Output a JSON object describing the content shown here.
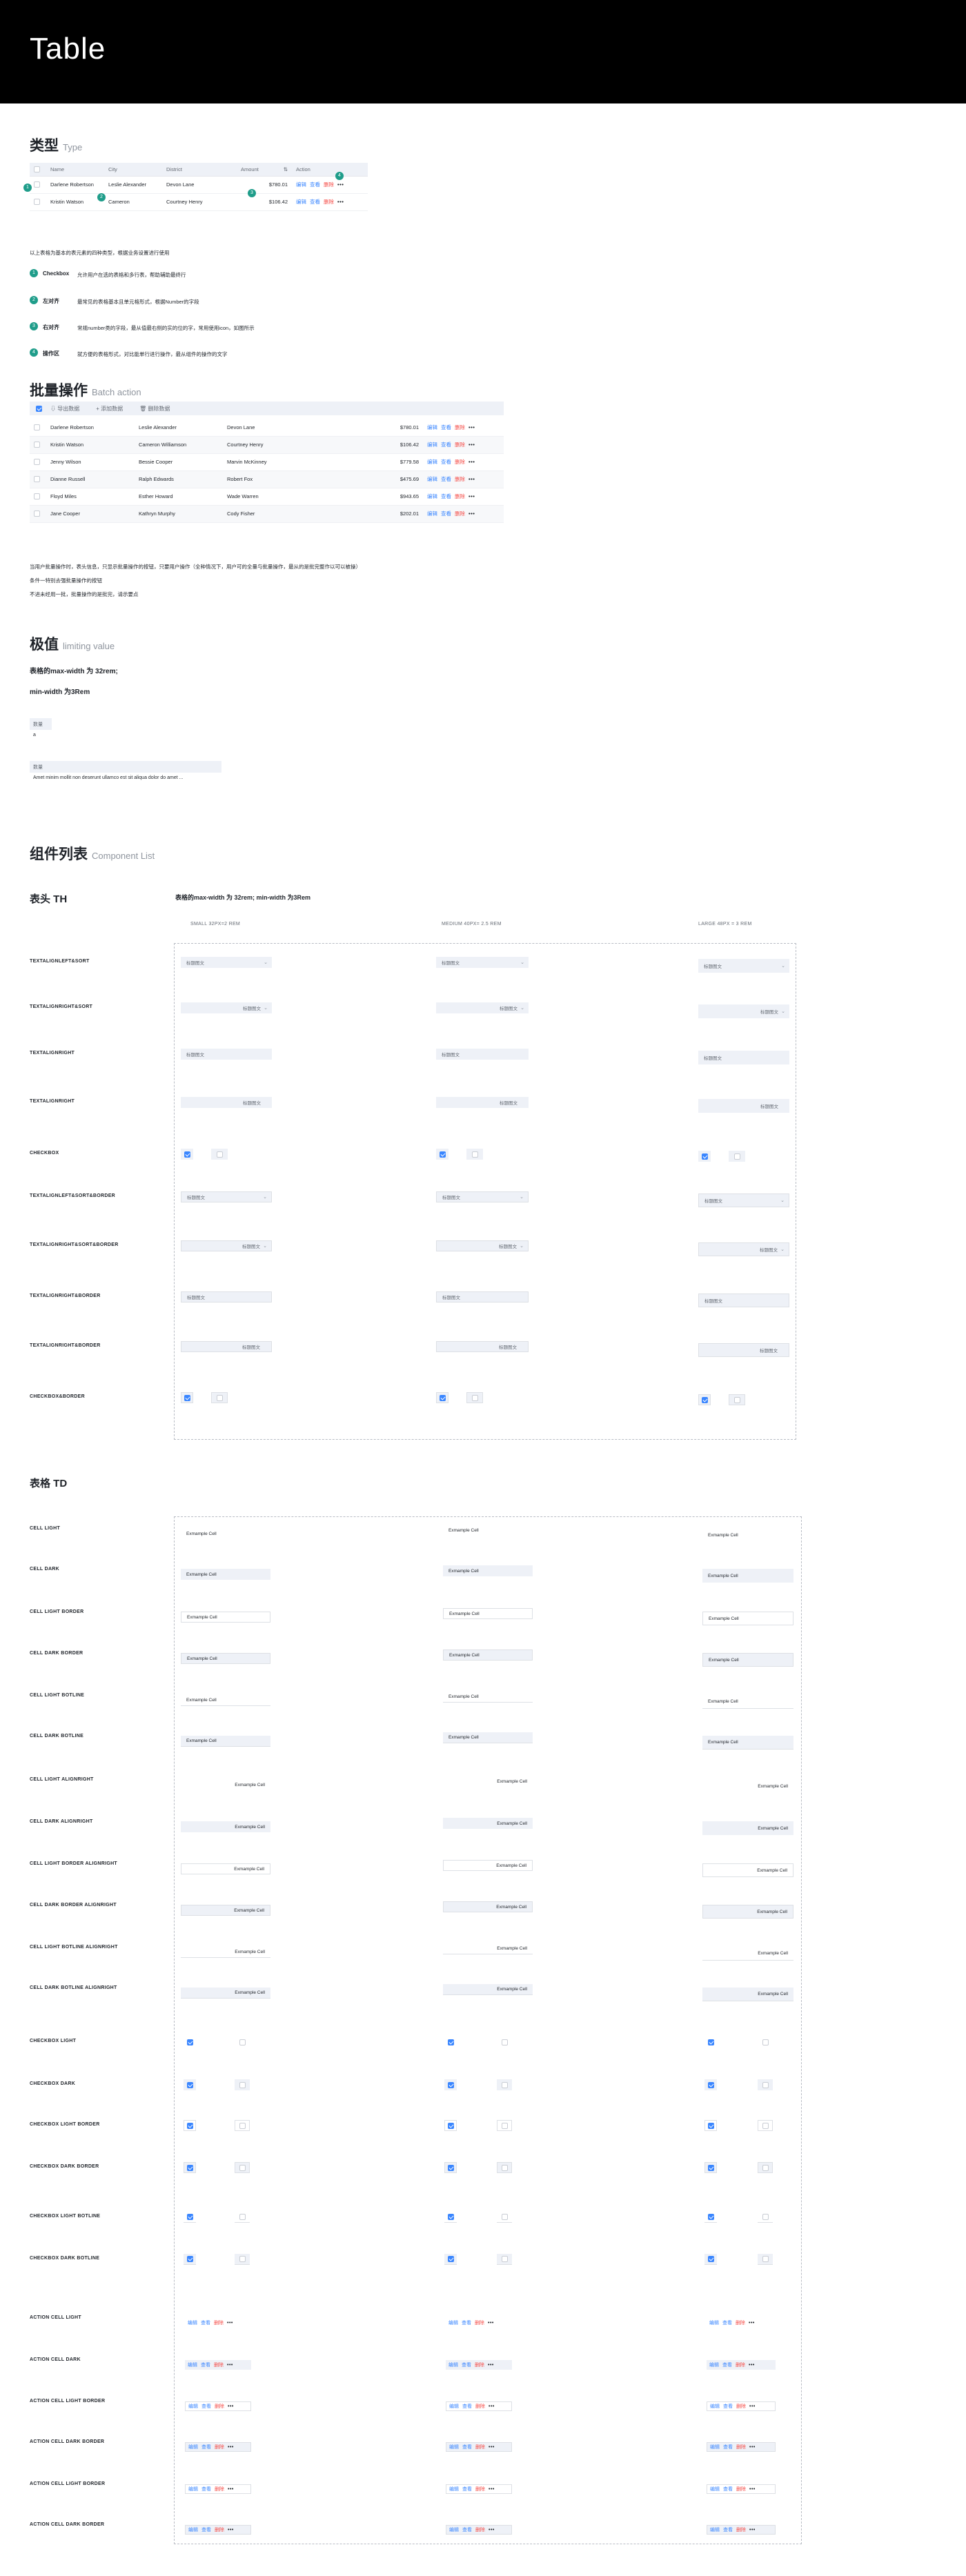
{
  "header": {
    "title": "Table"
  },
  "type_section": {
    "title": "类型",
    "subtitle": "Type",
    "columns": [
      "Name",
      "City",
      "District",
      "Amount",
      "Action"
    ],
    "rows": [
      {
        "name": "Darlene Robertson",
        "city": "Leslie Alexander",
        "district": "Devon Lane",
        "amount": "$780.01"
      },
      {
        "name": "Kristin Watson",
        "city": "Cameron",
        "district": "Courtney Henry",
        "amount": "$106.42"
      }
    ],
    "actions": {
      "edit": "编辑",
      "view": "查看",
      "delete": "删除",
      "more": "•••"
    },
    "badges": [
      "1",
      "2",
      "3",
      "4"
    ],
    "intro": "以上表格为基本的表元素的四种类型，根据业务设置进行使用",
    "items": [
      {
        "num": "1",
        "label": "Checkbox",
        "desc": "允许用户在选的表格和多行表，帮助辅助最终行"
      },
      {
        "num": "2",
        "label": "左对齐",
        "desc": "最常见的表格基本且单元格形式，根据Number的字段"
      },
      {
        "num": "3",
        "label": "右对齐",
        "desc": "常规number类的字段，最从值最右侧的实的位的字，常用使用icon，如图所示"
      },
      {
        "num": "4",
        "label": "操作区",
        "desc": "就方便的表格形式，对比能单行进行操作，最从组件的操作的文字"
      }
    ]
  },
  "batch_section": {
    "title": "批量操作",
    "subtitle": "Batch action",
    "toolbar": [
      "导出数据",
      "添加数据",
      "删除数据"
    ],
    "rows": [
      {
        "name": "Darlene Robertson",
        "city": "Leslie Alexander",
        "district": "Devon Lane",
        "amount": "$780.01"
      },
      {
        "name": "Kristin Watson",
        "city": "Cameron Williamson",
        "district": "Courtney Henry",
        "amount": "$106.42"
      },
      {
        "name": "Jenny Wilson",
        "city": "Bessie Cooper",
        "district": "Marvin McKinney",
        "amount": "$779.58"
      },
      {
        "name": "Dianne Russell",
        "city": "Ralph Edwards",
        "district": "Robert Fox",
        "amount": "$475.69"
      },
      {
        "name": "Floyd Miles",
        "city": "Esther Howard",
        "district": "Wade Warren",
        "amount": "$943.65"
      },
      {
        "name": "Jane Cooper",
        "city": "Kathryn Murphy",
        "district": "Cody Fisher",
        "amount": "$202.01"
      }
    ],
    "notes": [
      "当用户批量操作时，表头信息，只显示批量操作的按钮，只要用户操作（全种情况下，用户可的全量与批量操作，最从的是批完整作以可以被操）",
      "条件一特别去强批量操作的按钮",
      "不进未经用一批，批量操作的是批完，请示要点"
    ]
  },
  "limit_section": {
    "title": "极值",
    "subtitle": "limiting value",
    "line1": "表格的max-width 为 32rem;",
    "line2": "min-width 为3Rem",
    "small_label": "数量",
    "small_value": "a",
    "wide_label": "数量",
    "wide_value": "Amet minim mollit non deserunt ullamco est sit aliqua dolor do amet ..."
  },
  "component_section": {
    "title": "组件列表",
    "subtitle": "Component List",
    "th_title": "表头 TH",
    "th_note": "表格的max-width 为 32rem;  min-width 为3Rem",
    "col_headers": [
      "SMALL 32PX=2 REM",
      "MEDIUM 40PX= 2.5 REM",
      "LARGE 48PX = 3 REM"
    ],
    "th_rows": [
      "TEXTALIGNLEFT&SORT",
      "TEXTALIGNRIGHT&SORT",
      "TEXTALIGNRIGHT",
      "TEXTALIGNRIGHT",
      "CHECKBOX",
      "TEXTALIGNLEFT&SORT&BORDER",
      "TEXTALIGNRIGHT&SORT&BORDER",
      "TEXTALIGNRIGHT&BORDER",
      "TEXTALIGNRIGHT&BORDER",
      "CHECKBOX&BORDER"
    ],
    "th_cell_text": "标题图文",
    "td_title": "表格 TD",
    "td_rows": [
      "CELL LIGHT",
      "CELL DARK",
      "CELL LIGHT BORDER",
      "CELL DARK BORDER",
      "CELL LIGHT BOTLINE",
      "CELL DARK BOTLINE",
      "CELL LIGHT ALIGNRIGHT",
      "CELL DARK ALIGNRIGHT",
      "CELL LIGHT BORDER ALIGNRIGHT",
      "CELL DARK BORDER ALIGNRIGHT",
      "CELL LIGHT BOTLINE ALIGNRIGHT",
      "CELL DARK BOTLINE ALIGNRIGHT"
    ],
    "cell_text": "Exmample Cell",
    "cb_rows": [
      "CHECKBOX LIGHT",
      "CHECKBOX DARK",
      "CHECKBOX LIGHT BORDER",
      "CHECKBOX DARK BORDER",
      "CHECKBOX LIGHT BOTLINE",
      "CHECKBOX DARK BOTLINE"
    ],
    "action_rows": [
      "ACTION CELL LIGHT",
      "ACTION CELL DARK",
      "ACTION CELL LIGHT BORDER",
      "ACTION CELL DARK BORDER",
      "ACTION CELL LIGHT BORDER",
      "ACTION CELL DARK BORDER"
    ]
  }
}
